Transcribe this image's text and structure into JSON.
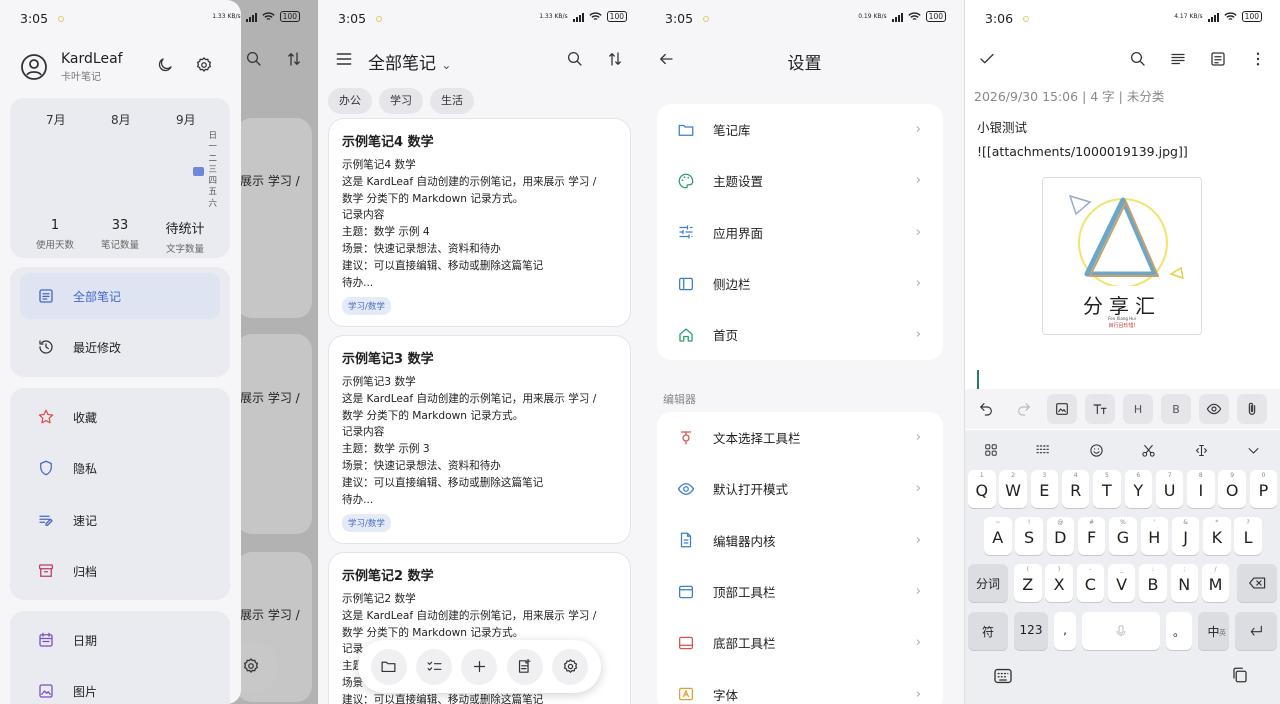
{
  "panel1": {
    "status": {
      "time": "3:05",
      "net_speed": "1.33 KB/s",
      "net_type": "5G",
      "battery": "100"
    },
    "user": {
      "name": "KardLeaf",
      "subtitle": "卡叶笔记"
    },
    "calendar": {
      "months": [
        "7月",
        "8月",
        "9月"
      ],
      "weekdays": [
        "日",
        "一",
        "二",
        "三",
        "四",
        "五",
        "六"
      ]
    },
    "stats": [
      {
        "value": "1",
        "label": "使用天数"
      },
      {
        "value": "33",
        "label": "笔记数量"
      },
      {
        "value": "待统计",
        "label": "文字数量"
      }
    ],
    "nav1": [
      {
        "label": "全部笔记",
        "icon": "notes-icon",
        "selected": true
      },
      {
        "label": "最近修改",
        "icon": "history-icon"
      }
    ],
    "nav2": [
      {
        "label": "收藏",
        "icon": "star-icon"
      },
      {
        "label": "隐私",
        "icon": "shield-icon"
      },
      {
        "label": "速记",
        "icon": "quick-note-icon"
      },
      {
        "label": "归档",
        "icon": "archive-icon"
      }
    ],
    "nav3": [
      {
        "label": "日期",
        "icon": "calendar-icon"
      },
      {
        "label": "图片",
        "icon": "image-icon"
      }
    ],
    "behind_text": [
      "展示 学习 /",
      "展示 学习 /",
      "展示 学习 /"
    ]
  },
  "panel2": {
    "status": {
      "time": "3:05",
      "net_speed": "1.33 KB/s",
      "net_type": "5G",
      "battery": "100"
    },
    "title": "全部笔记",
    "chips": [
      "办公",
      "学习",
      "生活"
    ],
    "cards": [
      {
        "title": "示例笔记4 数学",
        "lines": [
          "示例笔记4 数学",
          "这是 KardLeaf 自动创建的示例笔记，用来展示 学习 /",
          "数学 分类下的 Markdown 记录方式。",
          "记录内容",
          "主题：数学 示例 4",
          "场景：快速记录想法、资料和待办",
          "建议：可以直接编辑、移动或删除这篇笔记",
          "待办..."
        ],
        "tag": "学习/数学"
      },
      {
        "title": "示例笔记3 数学",
        "lines": [
          "示例笔记3 数学",
          "这是 KardLeaf 自动创建的示例笔记，用来展示 学习 /",
          "数学 分类下的 Markdown 记录方式。",
          "记录内容",
          "主题：数学 示例 3",
          "场景：快速记录想法、资料和待办",
          "建议：可以直接编辑、移动或删除这篇笔记",
          "待办..."
        ],
        "tag": "学习/数学"
      },
      {
        "title": "示例笔记2 数学",
        "lines": [
          "示例笔记2 数学",
          "这是 KardLeaf 自动创建的示例笔记，用来展示 学习 /",
          "数学 分类下的 Markdown 记录方式。",
          "记录",
          "主题",
          "场景",
          "建议：可以直接编辑、移动或删除这篇笔记"
        ],
        "tag": ""
      }
    ]
  },
  "panel3": {
    "status": {
      "time": "3:05",
      "net_speed": "0.19 KB/s",
      "net_type": "5G",
      "battery": "100"
    },
    "title": "设置",
    "group1": [
      {
        "label": "笔记库",
        "icon": "folder-icon",
        "color": "#3a7fd0"
      },
      {
        "label": "主题设置",
        "icon": "palette-icon",
        "color": "#2e9d6a"
      },
      {
        "label": "应用界面",
        "icon": "sliders-icon",
        "color": "#3a7fd0"
      },
      {
        "label": "侧边栏",
        "icon": "sidebar-icon",
        "color": "#3a7fd0"
      },
      {
        "label": "首页",
        "icon": "home-icon",
        "color": "#2e9d6a"
      }
    ],
    "editor_label": "编辑器",
    "group2": [
      {
        "label": "文本选择工具栏",
        "icon": "text-select-icon",
        "color": "#d9534f"
      },
      {
        "label": "默认打开模式",
        "icon": "eye-icon",
        "color": "#3a7fd0"
      },
      {
        "label": "编辑器内核",
        "icon": "document-icon",
        "color": "#3a7fd0"
      },
      {
        "label": "顶部工具栏",
        "icon": "top-toolbar-icon",
        "color": "#3a7fd0"
      },
      {
        "label": "底部工具栏",
        "icon": "bottom-toolbar-icon",
        "color": "#d9534f"
      },
      {
        "label": "字体",
        "icon": "font-icon",
        "color": "#e0a030"
      }
    ]
  },
  "panel4": {
    "status": {
      "time": "3:06",
      "net_speed": "4.17 KB/s",
      "net_type": "5G",
      "battery": "100"
    },
    "meta": "2026/9/30 15:06 | 4 字 | 未分类",
    "line1": "小银测试",
    "line2": "![[attachments/1000019139.jpg]]",
    "image_text": {
      "big": "分享汇",
      "pinyin": "Fen Xiang Hui",
      "slogan": "目行且珍惜!"
    },
    "toolbar": [
      "undo-icon",
      "redo-icon",
      "image-icon",
      "text-format-icon",
      "H",
      "B",
      "eye-icon",
      "attach-icon"
    ],
    "keyboard": {
      "row1": [
        [
          "Q",
          "1"
        ],
        [
          "W",
          "2"
        ],
        [
          "E",
          "3"
        ],
        [
          "R",
          "4"
        ],
        [
          "T",
          "5"
        ],
        [
          "Y",
          "6"
        ],
        [
          "U",
          "7"
        ],
        [
          "I",
          "8"
        ],
        [
          "O",
          "9"
        ],
        [
          "P",
          "0"
        ]
      ],
      "row2": [
        [
          "A",
          "~"
        ],
        [
          "S",
          "!"
        ],
        [
          "D",
          "@"
        ],
        [
          "F",
          "#"
        ],
        [
          "G",
          "%"
        ],
        [
          "H",
          "'"
        ],
        [
          "J",
          "&"
        ],
        [
          "K",
          "*"
        ],
        [
          "L",
          "?"
        ]
      ],
      "row3": [
        [
          "Z",
          "("
        ],
        [
          "X",
          ")"
        ],
        [
          "C",
          "-"
        ],
        [
          "V",
          "_"
        ],
        [
          "B",
          ":"
        ],
        [
          "N",
          ";"
        ],
        [
          "M",
          "/"
        ]
      ],
      "shift_label": "分词",
      "sym_label": "符",
      "num_label": "123",
      "comma": ",",
      "period": "。",
      "lang": "中",
      "lang_sub": "英"
    }
  }
}
